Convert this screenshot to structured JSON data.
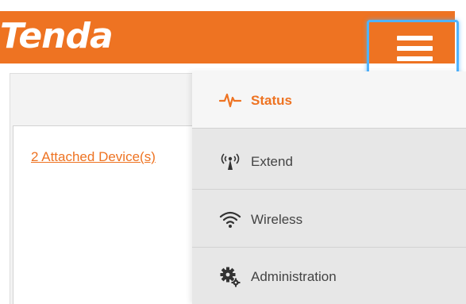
{
  "colors": {
    "brand": "#ee7322",
    "focus_ring": "#4fb3ff",
    "menu_bg": "#e7e7e7",
    "menu_active_bg": "#f6f6f6"
  },
  "header": {
    "logo_text": "Tenda",
    "menu_icon": "hamburger-menu-icon"
  },
  "page": {
    "attached_devices_link": "2 Attached Device(s)"
  },
  "menu": {
    "items": [
      {
        "label": "Status",
        "icon": "pulse-icon",
        "active": true
      },
      {
        "label": "Extend",
        "icon": "antenna-icon",
        "active": false
      },
      {
        "label": "Wireless",
        "icon": "wifi-icon",
        "active": false
      },
      {
        "label": "Administration",
        "icon": "gears-icon",
        "active": false
      }
    ]
  }
}
